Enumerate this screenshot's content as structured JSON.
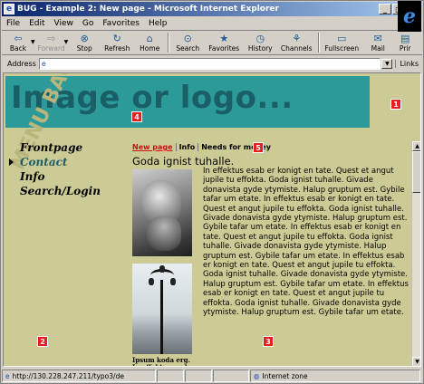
{
  "window": {
    "title": "BUG - Example 2: New page - Microsoft Internet Explorer",
    "icon_glyph": "e",
    "minimize_glyph": "_",
    "maximize_glyph": "□",
    "close_glyph": "✕"
  },
  "menu": [
    "File",
    "Edit",
    "View",
    "Go",
    "Favorites",
    "Help"
  ],
  "toolbar": [
    {
      "label": "Back",
      "icon": "back-arrow-icon",
      "glyph": "⇦"
    },
    {
      "label": "Forward",
      "icon": "forward-arrow-icon",
      "glyph": "⇨",
      "disabled": true
    },
    {
      "label": "Stop",
      "icon": "stop-icon",
      "glyph": "⊗"
    },
    {
      "label": "Refresh",
      "icon": "refresh-icon",
      "glyph": "↻"
    },
    {
      "label": "Home",
      "icon": "home-icon",
      "glyph": "⌂"
    },
    {
      "label": "Search",
      "icon": "search-icon",
      "glyph": "⊙"
    },
    {
      "label": "Favorites",
      "icon": "favorites-icon",
      "glyph": "★"
    },
    {
      "label": "History",
      "icon": "history-icon",
      "glyph": "◷"
    },
    {
      "label": "Channels",
      "icon": "channels-icon",
      "glyph": "⚘"
    },
    {
      "label": "Fullscreen",
      "icon": "fullscreen-icon",
      "glyph": "▭"
    },
    {
      "label": "Mail",
      "icon": "mail-icon",
      "glyph": "✉"
    },
    {
      "label": "Prir",
      "icon": "print-icon",
      "glyph": "▤"
    }
  ],
  "address": {
    "label": "Address",
    "value": "",
    "links_label": "Links"
  },
  "page": {
    "logo_text": "Image or logo...",
    "menu_background_text": "MENU BACKGROUND",
    "nav": [
      "Frontpage",
      "Contact",
      "Info",
      "Search/Login"
    ],
    "active_nav": "Contact",
    "tabs": [
      "New page",
      "Info",
      "Needs for money"
    ],
    "active_tab": "New page",
    "heading": "Goda ignist tuhalle.",
    "body": "In effektus esab er konigt en tate. Quest et angut jupile tu effokta. Goda ignist tuhalle. Givade donavista gyde ytymiste. Halup gruptum est. Gybile tafar um etate. In effektus esab er konigt en tate. Quest et angut jupile tu effokta. Goda ignist tuhalle. Givade donavista gyde ytymiste. Halup gruptum est. Gybile tafar um etate. In effektus esab er konigt en tate. Quest et angut jupile tu effokta. Goda ignist tuhalle. Givade donavista gyde ytymiste. Halup gruptum est. Gybile tafar um etate. In effektus esab er konigt en tate. Quest et angut jupile tu effokta. Goda ignist tuhalle. Givade donavista gyde ytymiste. Halup gruptum est. Gybile tafar um etate. In effektus esab er konigt en tate. Quest et angut jupile tu effokta. Goda ignist tuhalle. Givade donavista gyde ytymiste. Halup gruptum est. Gybile tafar um etate.",
    "caption": "Ipsum koda erg. In effektus esab",
    "markers": [
      "1",
      "2",
      "3",
      "4",
      "5"
    ]
  },
  "status": {
    "url": "http://130.228.247.211/typo3/de",
    "zone": "Internet zone"
  },
  "colors": {
    "content_bg": "#cdcb95",
    "header_bg": "#2d9a9a",
    "logo_text": "#1a5e66",
    "marker": "#e31f1f",
    "active_tab": "#cc1010"
  }
}
